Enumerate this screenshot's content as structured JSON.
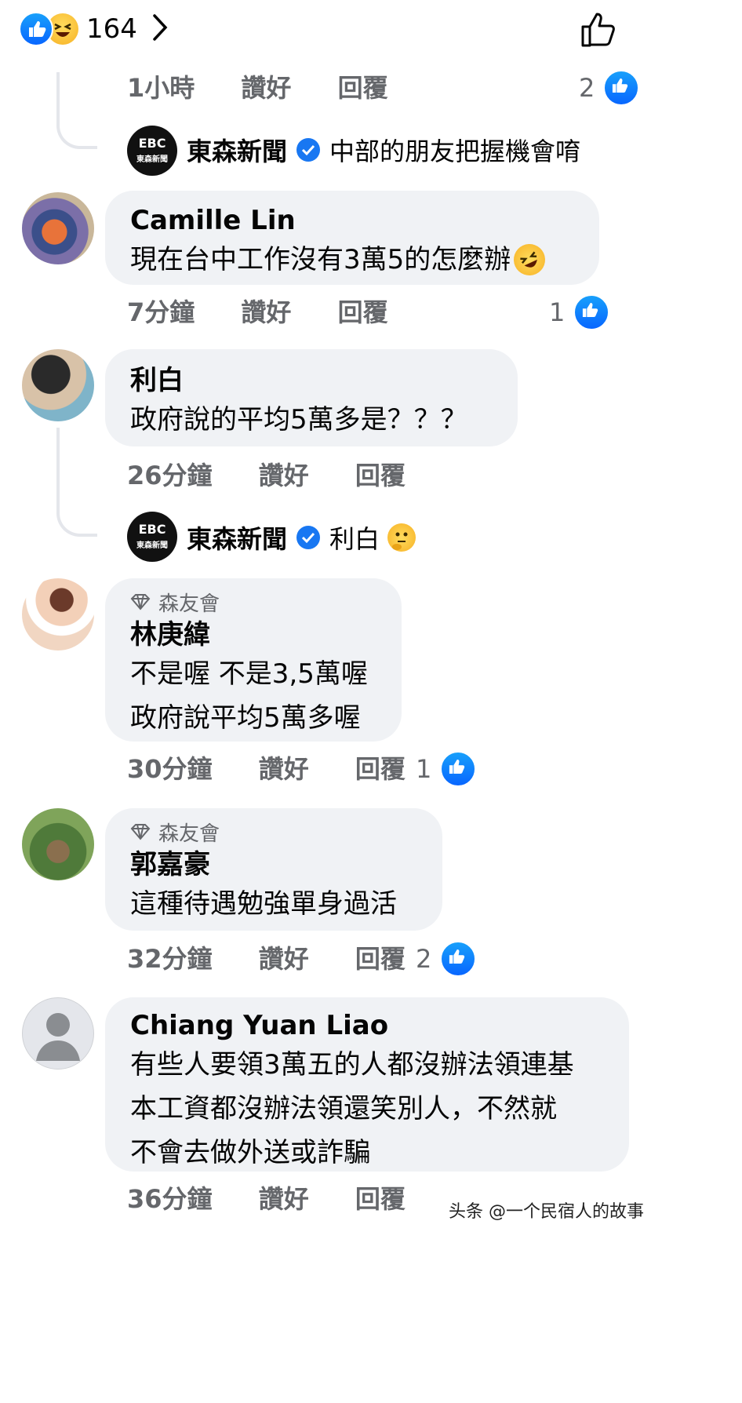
{
  "header": {
    "reaction_count": "164"
  },
  "comments": [
    {
      "time": "1小時",
      "like": "讚好",
      "reply": "回覆",
      "likes": "2"
    },
    {
      "name": "Camille Lin",
      "text": [
        "現在台中工作沒有3萬5的怎麼辦"
      ],
      "time": "7分鐘",
      "like": "讚好",
      "reply": "回覆",
      "likes": "1"
    },
    {
      "name": "利白",
      "text": [
        "政府說的平均5萬多是？？？"
      ],
      "time": "26分鐘",
      "like": "讚好",
      "reply": "回覆"
    },
    {
      "fan_badge": "森友會",
      "name": "林庚緯",
      "text": [
        "不是喔 不是3,5萬喔",
        "政府說平均5萬多喔"
      ],
      "time": "30分鐘",
      "like": "讚好",
      "reply": "回覆",
      "likes": "1"
    },
    {
      "fan_badge": "森友會",
      "name": "郭嘉豪",
      "text": [
        "這種待遇勉強單身過活"
      ],
      "time": "32分鐘",
      "like": "讚好",
      "reply": "回覆",
      "likes": "2"
    },
    {
      "name": "Chiang Yuan Liao",
      "text": [
        "有些人要領3萬五的人都沒辦法領連基",
        "本工資都沒辦法領還笑別人，不然就",
        "不會去做外送或詐騙"
      ],
      "time": "36分鐘",
      "like": "讚好",
      "reply": "回覆"
    }
  ],
  "replies": [
    {
      "page": "東森新聞",
      "logo": "EBC",
      "logo_sub": "東森新聞",
      "text": "中部的朋友把握機會唷"
    },
    {
      "page": "東森新聞",
      "logo": "EBC",
      "logo_sub": "東森新聞",
      "text": "利白"
    }
  ],
  "watermark": "头条 @一个民宿人的故事",
  "colors": {
    "meta": "#65676b",
    "bubble": "#f0f2f5",
    "like_blue": "#0866ff"
  }
}
